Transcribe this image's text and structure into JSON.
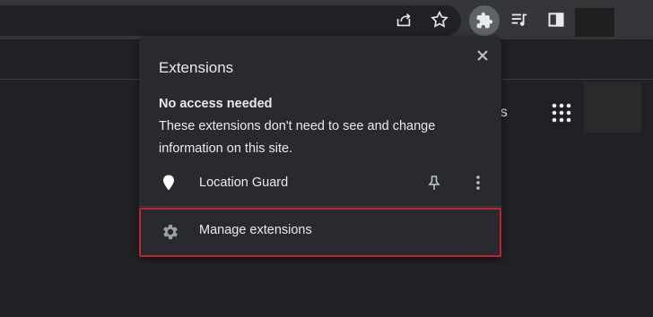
{
  "toolbar": {
    "icons": [
      "share-icon",
      "star-icon",
      "extensions-puzzle-icon",
      "media-queue-icon",
      "side-panel-icon"
    ]
  },
  "page": {
    "partial_text": "ges"
  },
  "popup": {
    "title": "Extensions",
    "section_heading": "No access needed",
    "section_description": "These extensions don't need to see and change information on this site.",
    "extensions": [
      {
        "name": "Location Guard",
        "icon": "location-pin-icon"
      }
    ],
    "manage_label": "Manage extensions"
  },
  "colors": {
    "toolbar_bg": "#35363a",
    "page_bg": "#202124",
    "popup_bg": "#292a2d",
    "text": "#e8eaed",
    "highlight_border": "#c0242d"
  }
}
